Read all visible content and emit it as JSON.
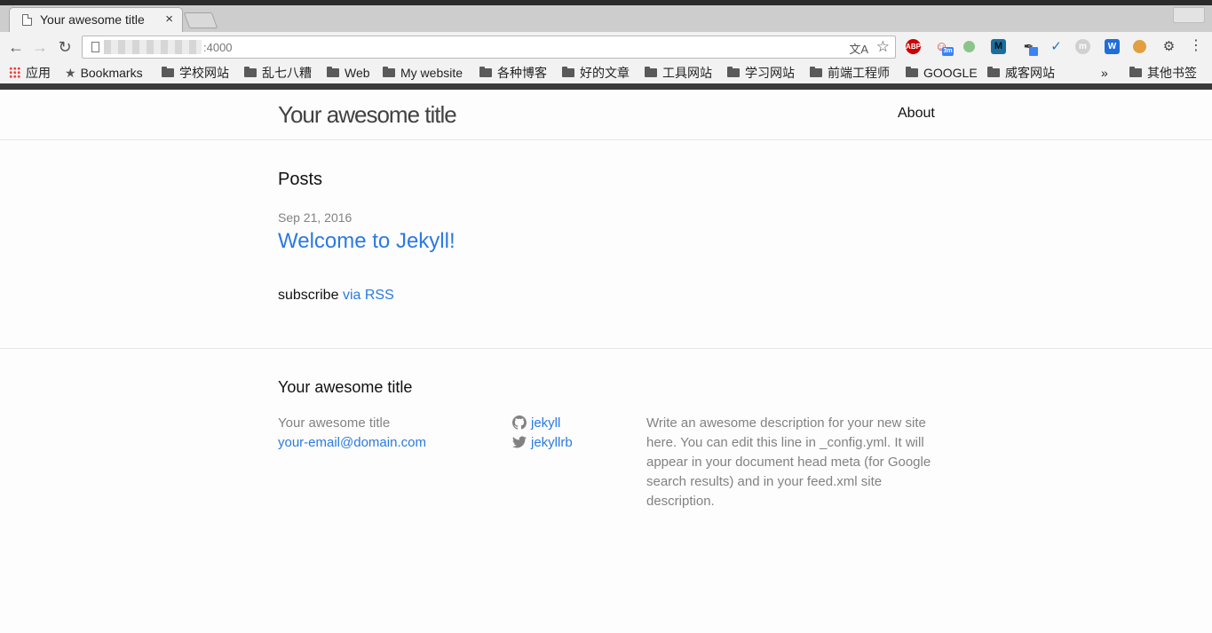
{
  "browser": {
    "tab_title": "Your awesome title",
    "tab_close": "×",
    "url_port": ":4000",
    "bookmarks": [
      {
        "label": "应用",
        "icon": "apps-grid-icon"
      },
      {
        "label": "Bookmarks",
        "icon": "star-icon"
      },
      {
        "label": "学校网站",
        "icon": "folder-icon"
      },
      {
        "label": "乱七八糟",
        "icon": "folder-icon"
      },
      {
        "label": "Web",
        "icon": "folder-icon"
      },
      {
        "label": "My website",
        "icon": "folder-icon"
      },
      {
        "label": "各种博客",
        "icon": "folder-icon"
      },
      {
        "label": "好的文章",
        "icon": "folder-icon"
      },
      {
        "label": "工具网站",
        "icon": "folder-icon"
      },
      {
        "label": "学习网站",
        "icon": "folder-icon"
      },
      {
        "label": "前端工程师",
        "icon": "folder-icon"
      },
      {
        "label": "GOOGLE",
        "icon": "folder-icon"
      },
      {
        "label": "威客网站",
        "icon": "folder-icon"
      }
    ],
    "bookmarks_overflow": "»",
    "other_bookmarks": "其他书签",
    "extensions": {
      "abp_label": "ABP",
      "timer_badge": "3m",
      "m_label": "M",
      "w_label": "W"
    }
  },
  "site": {
    "title": "Your awesome title",
    "nav": {
      "about": "About"
    },
    "posts_heading": "Posts",
    "posts": [
      {
        "date": "Sep 21, 2016",
        "title": "Welcome to Jekyll!"
      }
    ],
    "subscribe_text": "subscribe",
    "subscribe_link": "via RSS",
    "footer": {
      "heading": "Your awesome title",
      "name": "Your awesome title",
      "email": "your-email@domain.com",
      "github": "jekyll",
      "twitter": "jekyllrb",
      "description": "Write an awesome description for your new site here. You can edit this line in _config.yml. It will appear in your document head meta (for Google search results) and in your feed.xml site description."
    }
  },
  "colors": {
    "link": "#2a7ae2",
    "muted": "#828282",
    "title": "#424242"
  }
}
